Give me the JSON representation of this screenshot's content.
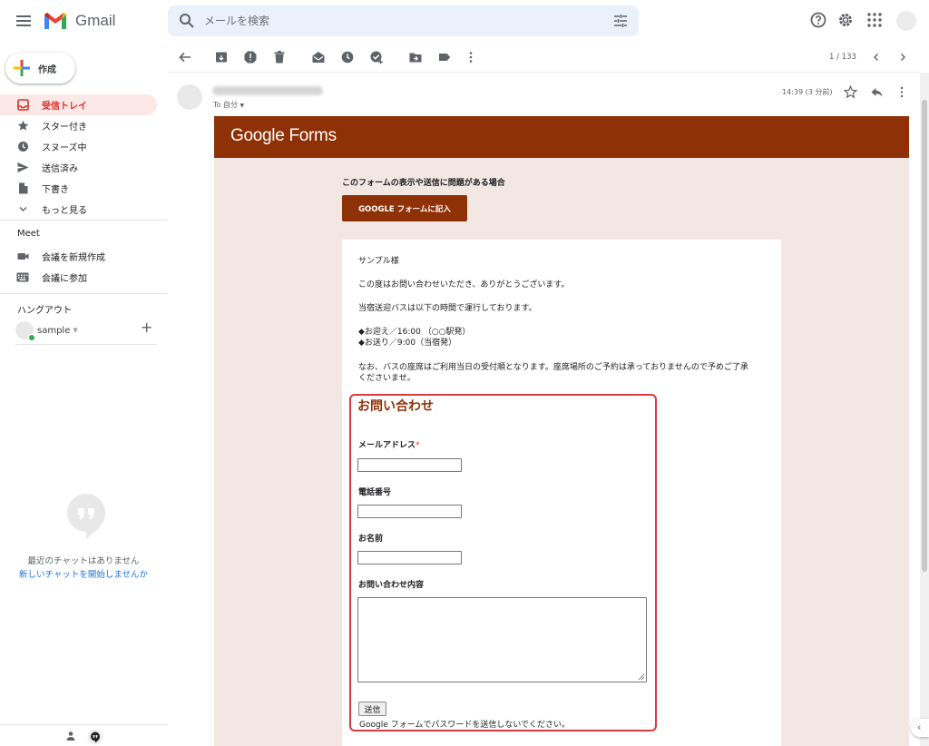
{
  "app": {
    "name": "Gmail"
  },
  "search": {
    "placeholder": "メールを検索"
  },
  "sidebar": {
    "compose_label": "作成",
    "items": [
      {
        "label": "受信トレイ",
        "icon": "inbox-icon"
      },
      {
        "label": "スター付き",
        "icon": "star-icon"
      },
      {
        "label": "スヌーズ中",
        "icon": "clock-icon"
      },
      {
        "label": "送信済み",
        "icon": "send-icon"
      },
      {
        "label": "下書き",
        "icon": "draft-icon"
      },
      {
        "label": "もっと見る",
        "icon": "chevron-down-icon"
      }
    ],
    "meet": {
      "title": "Meet",
      "items": [
        {
          "label": "会議を新規作成",
          "icon": "videocam-icon"
        },
        {
          "label": "会議に参加",
          "icon": "keyboard-icon"
        }
      ]
    },
    "hangouts": {
      "title": "ハングアウト",
      "user_name": "sample",
      "empty_text": "最近のチャットはありません",
      "start_link": "新しいチャットを開始しませんか"
    }
  },
  "toolbar": {
    "pager": "1 / 133"
  },
  "message": {
    "to_line": "To 自分",
    "time": "14:39 (3 分前)"
  },
  "email": {
    "banner_title": "Google Forms",
    "problem_text": "このフォームの表示や送信に問題がある場合",
    "fill_button": "GOOGLE フォームに記入",
    "greeting": "サンプル様",
    "line1": "この度はお問い合わせいただき、ありがとうございます。",
    "line2": "当宿送迎バスは以下の時間で運行しております。",
    "pickup": "◆お迎え／16:00 （○○駅発）",
    "dropoff": "◆お送り／9:00（当宿発）",
    "note1": "なお、バスの座席はご利用当日の受付順となります。座席場所のご予約は承っておりませんので予めご了承",
    "note2": "くださいませ。",
    "form": {
      "title": "お問い合わせ",
      "email_label": "メールアドレス",
      "required_mark": "*",
      "phone_label": "電話番号",
      "name_label": "お名前",
      "content_label": "お問い合わせ内容",
      "submit": "送信",
      "password_warning": "Google フォームでパスワードを送信しないでください。"
    }
  },
  "colors": {
    "forms_brand": "#8f3106",
    "email_background": "#f3e7e3",
    "highlight_border": "#d93a3f",
    "inbox_active_bg": "#fce8e6"
  }
}
